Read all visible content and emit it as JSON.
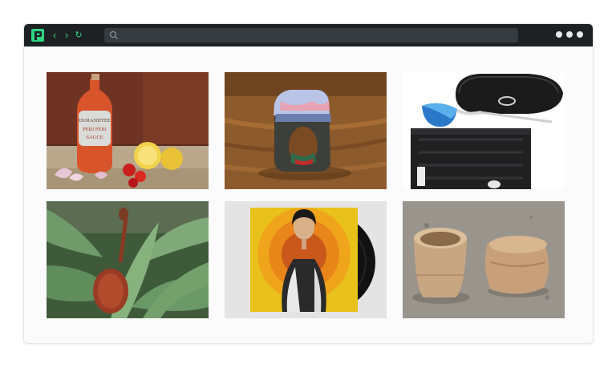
{
  "browser": {
    "search": {
      "value": "",
      "placeholder": ""
    },
    "accent_color": "#2ed47f",
    "titlebar_color": "#1d2124"
  },
  "gallery": {
    "items": [
      {
        "subject": "hot sauce bottle",
        "label_lines": [
          "DURANHTEE",
          "PERI PERI",
          "SAUCE"
        ]
      },
      {
        "subject": "resin wood ring"
      },
      {
        "subject": "sunglasses with case",
        "case_logo": "oakley-logo"
      },
      {
        "subject": "wooden spoon on aloe"
      },
      {
        "subject": "vinyl record album cover"
      },
      {
        "subject": "wooden cups"
      }
    ]
  }
}
